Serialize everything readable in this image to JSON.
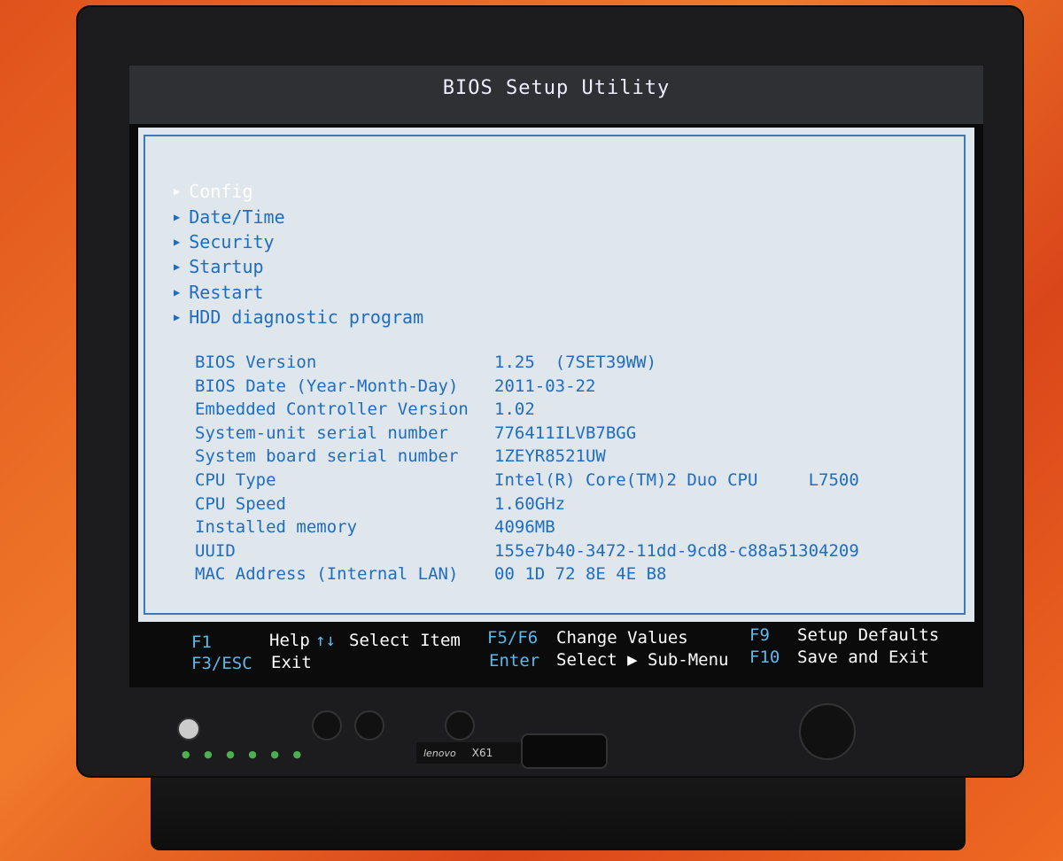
{
  "title": "BIOS Setup Utility",
  "menu": [
    {
      "label": "Config",
      "selected": true
    },
    {
      "label": "Date/Time"
    },
    {
      "label": "Security"
    },
    {
      "label": "Startup"
    },
    {
      "label": "Restart"
    },
    {
      "label": "HDD diagnostic program"
    }
  ],
  "info": [
    {
      "label": "BIOS Version",
      "value": "1.25  (7SET39WW)"
    },
    {
      "label": "BIOS Date (Year-Month-Day)",
      "value": "2011-03-22"
    },
    {
      "label": "Embedded Controller Version",
      "value": "1.02"
    },
    {
      "label": "System-unit serial number",
      "value": "776411ILVB7BGG"
    },
    {
      "label": "System board serial number",
      "value": "1ZEYR8521UW"
    },
    {
      "label": "CPU Type",
      "value": "Intel(R) Core(TM)2 Duo CPU     L7500"
    },
    {
      "label": "CPU Speed",
      "value": "1.60GHz"
    },
    {
      "label": "Installed memory",
      "value": "4096MB"
    },
    {
      "label": "UUID",
      "value": "155e7b40-3472-11dd-9cd8-c88a51304209"
    },
    {
      "label": "MAC Address (Internal LAN)",
      "value": "00 1D 72 8E 4E B8"
    }
  ],
  "footer": {
    "f1_key": "F1",
    "f1_label": "Help",
    "arrows_key": "↑↓",
    "arrows_label": "Select Item",
    "f56_key": "F5/F6",
    "f56_label": "Change Values",
    "f9_key": "F9",
    "f9_label": "Setup Defaults",
    "esc_key": "F3/ESC",
    "esc_label": "Exit",
    "enter_key": "Enter",
    "enter_label": "Select ▶ Sub-Menu",
    "f10_key": "F10",
    "f10_label": "Save and Exit"
  },
  "device": {
    "brand": "lenovo",
    "model": "X61"
  },
  "colors": {
    "text": "#1f6dc0",
    "key": "#5fb8e8",
    "panel": "#dfe6ec"
  }
}
